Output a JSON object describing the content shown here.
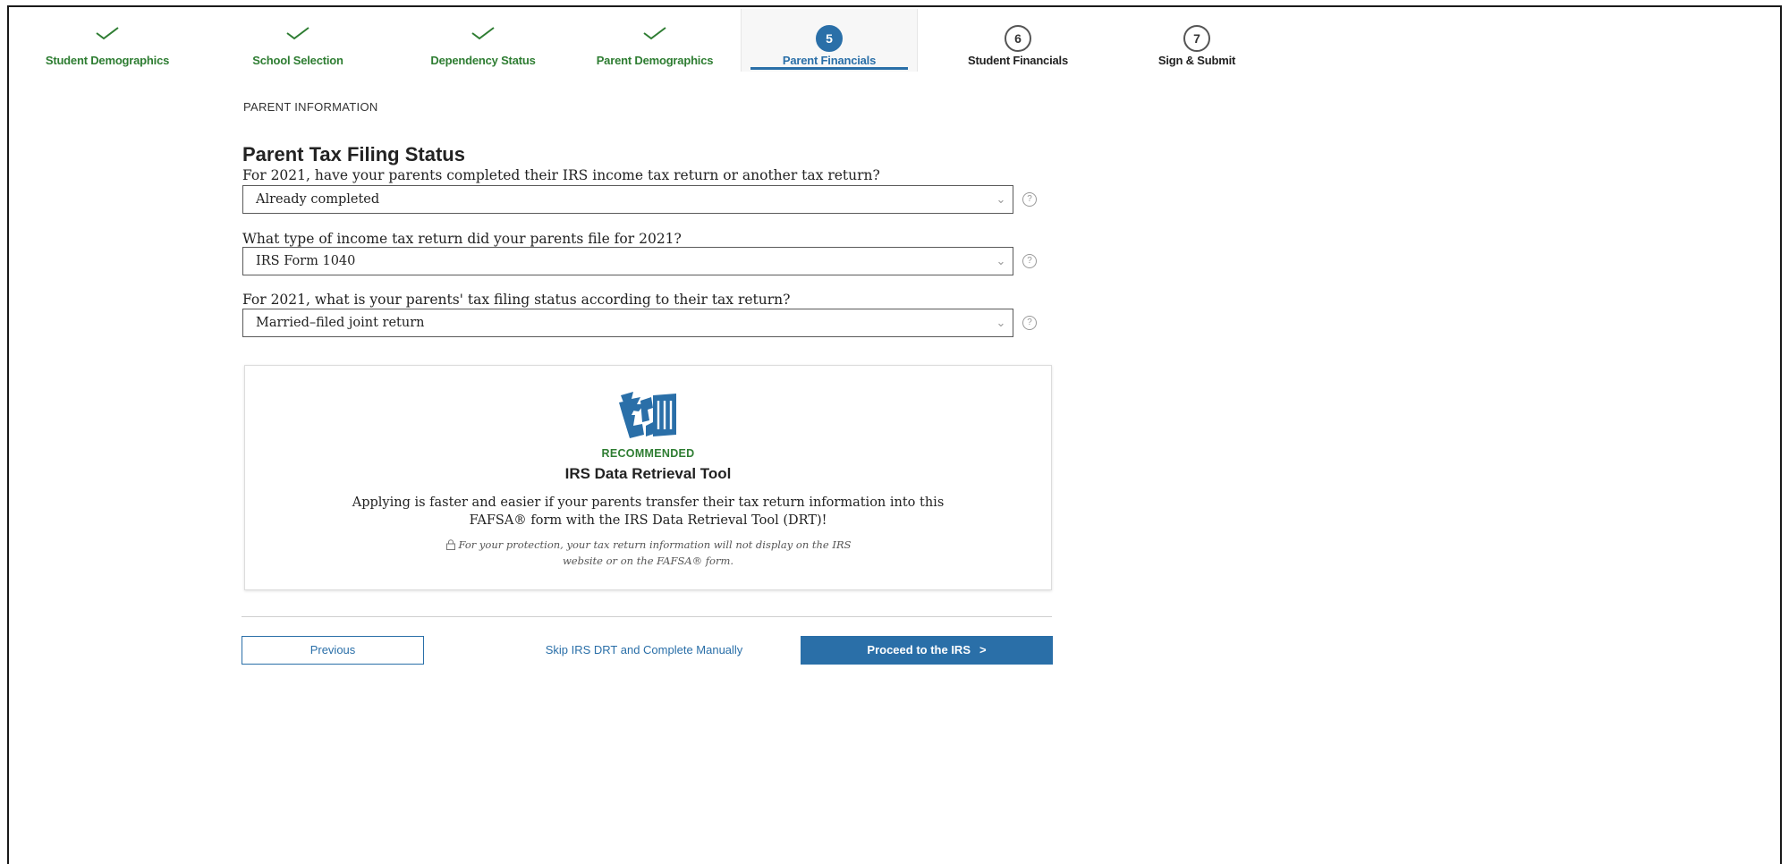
{
  "steps": [
    {
      "label": "Student Demographics",
      "state": "done",
      "icon": "check-icon"
    },
    {
      "label": "School Selection",
      "state": "done",
      "icon": "check-icon"
    },
    {
      "label": "Dependency Status",
      "state": "done",
      "icon": "check-icon"
    },
    {
      "label": "Parent Demographics",
      "state": "done",
      "icon": "check-icon"
    },
    {
      "label": "Parent Financials",
      "state": "current",
      "number": "5"
    },
    {
      "label": "Student Financials",
      "state": "todo",
      "number": "6"
    },
    {
      "label": "Sign & Submit",
      "state": "todo",
      "number": "7"
    }
  ],
  "section": {
    "eyebrow": "PARENT INFORMATION",
    "title": "Parent Tax Filing Status"
  },
  "questions": [
    {
      "label": "For 2021, have your parents completed their IRS income tax return or another tax return?",
      "value": "Already completed"
    },
    {
      "label": "What type of income tax return did your parents file for 2021?",
      "value": "IRS Form 1040"
    },
    {
      "label": "For 2021, what is your parents' tax filing status according to their tax return?",
      "value": "Married–filed joint return"
    }
  ],
  "drt_card": {
    "logo_icon": "irs-eagle-logo",
    "eyebrow": "RECOMMENDED",
    "title": "IRS Data Retrieval Tool",
    "body_line1": "Applying is faster and easier if your parents transfer their tax return information into this",
    "body_line2": "FAFSA® form with the IRS Data Retrieval Tool (DRT)!",
    "note_line1": "For your protection, your tax return information will not display on the IRS",
    "note_line2": "website or on the FAFSA® form."
  },
  "nav": {
    "previous_label": "Previous",
    "skip_label": "Skip IRS DRT and Complete Manually",
    "proceed_label": "Proceed to the IRS",
    "proceed_arrow": ">"
  },
  "colors": {
    "accent_blue": "#2a6fa8",
    "done_green": "#2e7d32",
    "border_gray": "#5a5a5a"
  }
}
